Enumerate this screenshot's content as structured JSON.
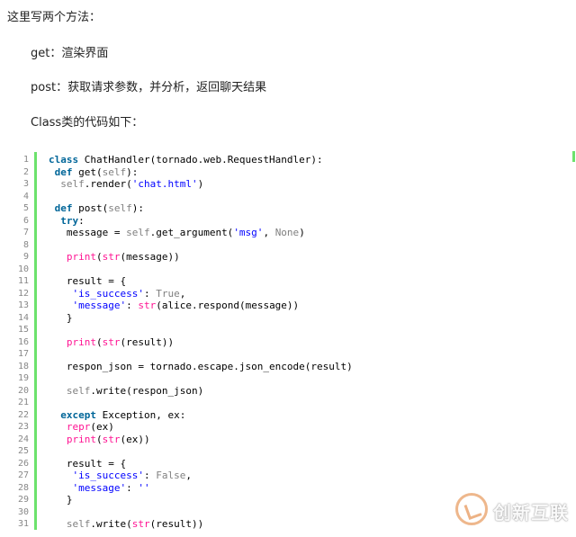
{
  "paragraphs": [
    "这里写两个方法：",
    "get：渲染界面",
    "post：获取请求参数，并分析，返回聊天结果",
    "Class类的代码如下："
  ],
  "code": {
    "line_numbers": [
      "1",
      "2",
      "3",
      "4",
      "5",
      "6",
      "7",
      "8",
      "9",
      "10",
      "11",
      "12",
      "13",
      "14",
      "15",
      "16",
      "17",
      "18",
      "19",
      "20",
      "21",
      "22",
      "23",
      "24",
      "25",
      "26",
      "27",
      "28",
      "29",
      "30",
      "31"
    ],
    "lines": [
      [
        {
          "t": "class",
          "c": "kw"
        },
        {
          "t": " ChatHandler(tornado.web.RequestHandler):"
        }
      ],
      [
        {
          "t": " "
        },
        {
          "t": "def",
          "c": "kw"
        },
        {
          "t": " get("
        },
        {
          "t": "self",
          "c": "self"
        },
        {
          "t": "):"
        }
      ],
      [
        {
          "t": "  "
        },
        {
          "t": "self",
          "c": "self"
        },
        {
          "t": ".render("
        },
        {
          "t": "'chat.html'",
          "c": "st"
        },
        {
          "t": ")"
        }
      ],
      [],
      [
        {
          "t": " "
        },
        {
          "t": "def",
          "c": "kw"
        },
        {
          "t": " post("
        },
        {
          "t": "self",
          "c": "self"
        },
        {
          "t": "):"
        }
      ],
      [
        {
          "t": "  "
        },
        {
          "t": "try",
          "c": "kw"
        },
        {
          "t": ":"
        }
      ],
      [
        {
          "t": "   message = "
        },
        {
          "t": "self",
          "c": "self"
        },
        {
          "t": ".get_argument("
        },
        {
          "t": "'msg'",
          "c": "st"
        },
        {
          "t": ", "
        },
        {
          "t": "None",
          "c": "none"
        },
        {
          "t": ")"
        }
      ],
      [],
      [
        {
          "t": "   "
        },
        {
          "t": "print",
          "c": "fn"
        },
        {
          "t": "("
        },
        {
          "t": "str",
          "c": "fn"
        },
        {
          "t": "(message))"
        }
      ],
      [],
      [
        {
          "t": "   result = {"
        }
      ],
      [
        {
          "t": "    "
        },
        {
          "t": "'is_success'",
          "c": "st"
        },
        {
          "t": ": "
        },
        {
          "t": "True",
          "c": "truefalse"
        },
        {
          "t": ","
        }
      ],
      [
        {
          "t": "    "
        },
        {
          "t": "'message'",
          "c": "st"
        },
        {
          "t": ": "
        },
        {
          "t": "str",
          "c": "fn"
        },
        {
          "t": "(alice.respond(message))"
        }
      ],
      [
        {
          "t": "   }"
        }
      ],
      [],
      [
        {
          "t": "   "
        },
        {
          "t": "print",
          "c": "fn"
        },
        {
          "t": "("
        },
        {
          "t": "str",
          "c": "fn"
        },
        {
          "t": "(result))"
        }
      ],
      [],
      [
        {
          "t": "   respon_json = tornado.escape.json_encode(result)"
        }
      ],
      [],
      [
        {
          "t": "   "
        },
        {
          "t": "self",
          "c": "self"
        },
        {
          "t": ".write(respon_json)"
        }
      ],
      [],
      [
        {
          "t": "  "
        },
        {
          "t": "except",
          "c": "kw"
        },
        {
          "t": " Exception, ex:"
        }
      ],
      [
        {
          "t": "   "
        },
        {
          "t": "repr",
          "c": "fn"
        },
        {
          "t": "(ex)"
        }
      ],
      [
        {
          "t": "   "
        },
        {
          "t": "print",
          "c": "fn"
        },
        {
          "t": "("
        },
        {
          "t": "str",
          "c": "fn"
        },
        {
          "t": "(ex))"
        }
      ],
      [],
      [
        {
          "t": "   result = {"
        }
      ],
      [
        {
          "t": "    "
        },
        {
          "t": "'is_success'",
          "c": "st"
        },
        {
          "t": ": "
        },
        {
          "t": "False",
          "c": "truefalse"
        },
        {
          "t": ","
        }
      ],
      [
        {
          "t": "    "
        },
        {
          "t": "'message'",
          "c": "st"
        },
        {
          "t": ": "
        },
        {
          "t": "''",
          "c": "st"
        }
      ],
      [
        {
          "t": "   }"
        }
      ],
      [],
      [
        {
          "t": "   "
        },
        {
          "t": "self",
          "c": "self"
        },
        {
          "t": ".write("
        },
        {
          "t": "str",
          "c": "fn"
        },
        {
          "t": "(result))"
        }
      ]
    ]
  },
  "watermark": {
    "text": "创新互联"
  },
  "colors": {
    "keyword": "#006699",
    "builtin": "#ff1493",
    "string": "#0000ff",
    "gutter_bar": "#6ce26c"
  }
}
